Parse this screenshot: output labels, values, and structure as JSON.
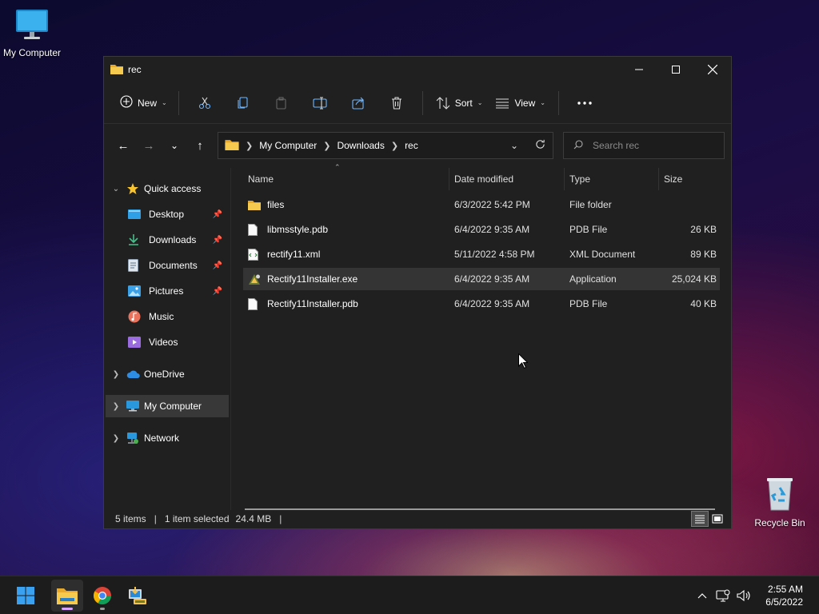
{
  "desktop": {
    "my_computer_label": "My Computer",
    "recycle_bin_label": "Recycle Bin"
  },
  "window": {
    "title": "rec",
    "toolbar": {
      "new_label": "New",
      "sort_label": "Sort",
      "view_label": "View"
    },
    "address": {
      "crumbs": [
        "My Computer",
        "Downloads",
        "rec"
      ],
      "search_placeholder": "Search rec"
    },
    "nav": {
      "quick_access": "Quick access",
      "desktop": "Desktop",
      "downloads": "Downloads",
      "documents": "Documents",
      "pictures": "Pictures",
      "music": "Music",
      "videos": "Videos",
      "onedrive": "OneDrive",
      "my_computer": "My Computer",
      "network": "Network"
    },
    "columns": {
      "name": "Name",
      "date": "Date modified",
      "type": "Type",
      "size": "Size"
    },
    "files": [
      {
        "name": "files",
        "date": "6/3/2022 5:42 PM",
        "type": "File folder",
        "size": "",
        "icon": "folder-icon"
      },
      {
        "name": "libmsstyle.pdb",
        "date": "6/4/2022 9:35 AM",
        "type": "PDB File",
        "size": "26 KB",
        "icon": "file-icon"
      },
      {
        "name": "rectify11.xml",
        "date": "5/11/2022 4:58 PM",
        "type": "XML Document",
        "size": "89 KB",
        "icon": "xml-file-icon"
      },
      {
        "name": "Rectify11Installer.exe",
        "date": "6/4/2022 9:35 AM",
        "type": "Application",
        "size": "25,024 KB",
        "icon": "app-icon",
        "selected": true
      },
      {
        "name": "Rectify11Installer.pdb",
        "date": "6/4/2022 9:35 AM",
        "type": "PDB File",
        "size": "40 KB",
        "icon": "file-icon"
      }
    ],
    "status": {
      "items": "5 items",
      "selection": "1 item selected",
      "size": "24.4 MB"
    }
  },
  "taskbar": {
    "time": "2:55 AM",
    "date": "6/5/2022"
  },
  "colors": {
    "window_bg": "#202020",
    "selection": "#343434",
    "accent_folder": "#f2c14e"
  }
}
